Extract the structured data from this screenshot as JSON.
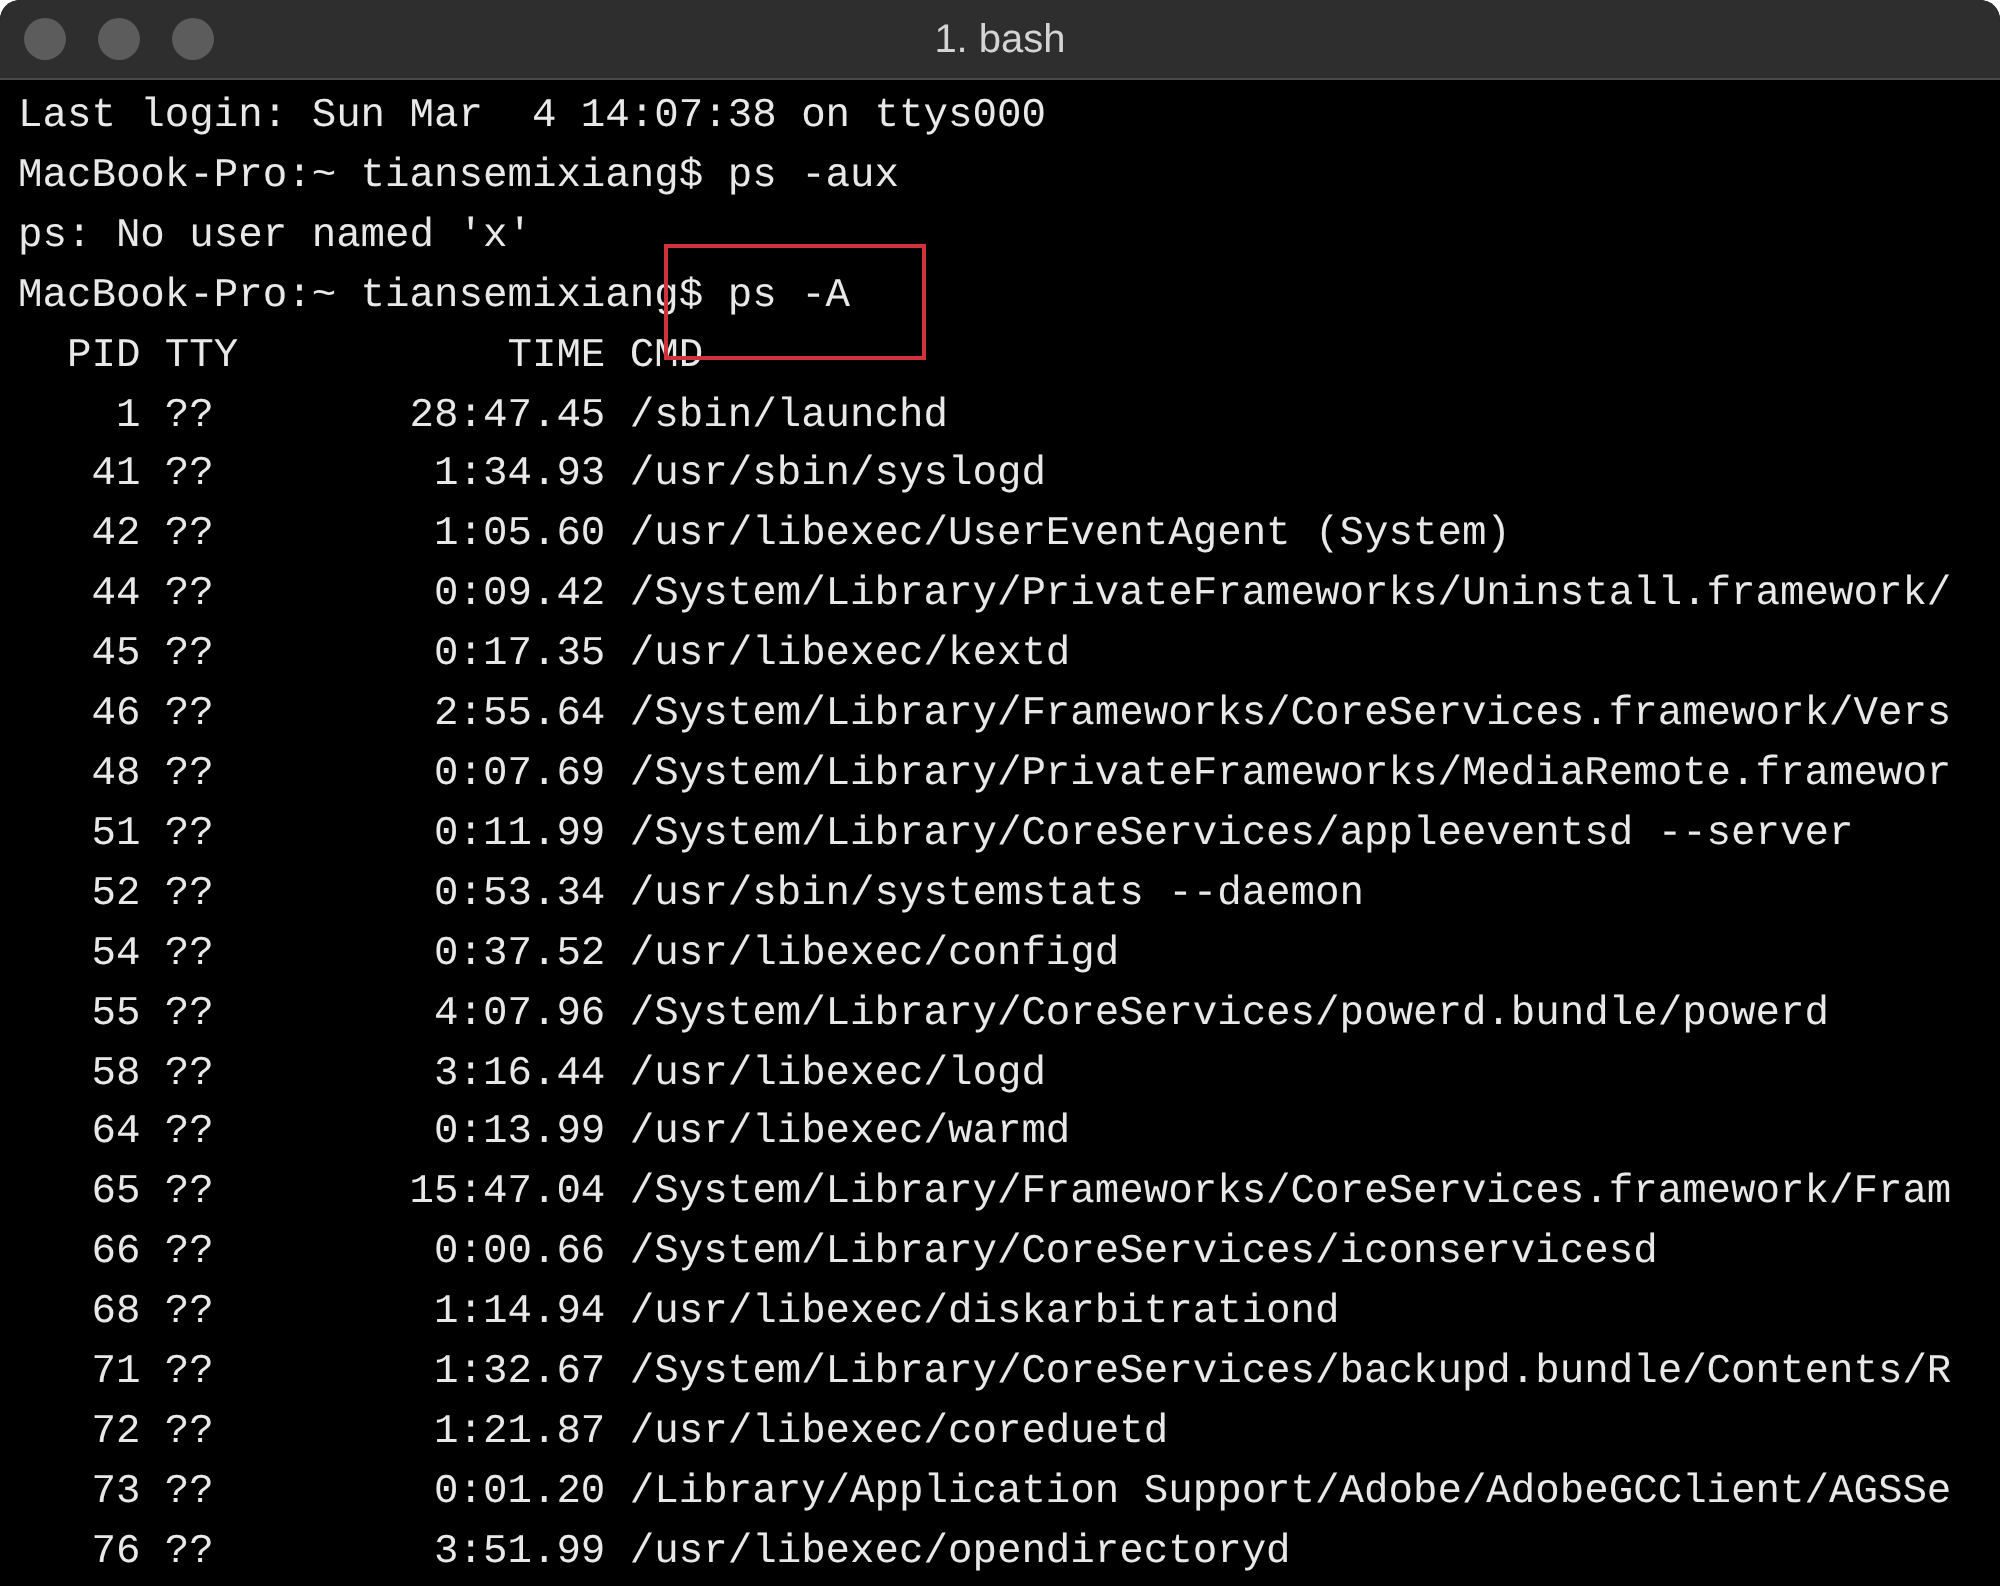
{
  "window": {
    "title": "1. bash"
  },
  "lines": [
    "Last login: Sun Mar  4 14:07:38 on ttys000",
    "MacBook-Pro:~ tiansemixiang$ ps -aux",
    "ps: No user named 'x'",
    "MacBook-Pro:~ tiansemixiang$ ps -A"
  ],
  "ps_table": {
    "columns": [
      "PID",
      "TTY",
      "TIME",
      "CMD"
    ],
    "rows": [
      {
        "pid": "1",
        "tty": "??",
        "time": "28:47.45",
        "cmd": "/sbin/launchd"
      },
      {
        "pid": "41",
        "tty": "??",
        "time": "1:34.93",
        "cmd": "/usr/sbin/syslogd"
      },
      {
        "pid": "42",
        "tty": "??",
        "time": "1:05.60",
        "cmd": "/usr/libexec/UserEventAgent (System)"
      },
      {
        "pid": "44",
        "tty": "??",
        "time": "0:09.42",
        "cmd": "/System/Library/PrivateFrameworks/Uninstall.framework/"
      },
      {
        "pid": "45",
        "tty": "??",
        "time": "0:17.35",
        "cmd": "/usr/libexec/kextd"
      },
      {
        "pid": "46",
        "tty": "??",
        "time": "2:55.64",
        "cmd": "/System/Library/Frameworks/CoreServices.framework/Vers"
      },
      {
        "pid": "48",
        "tty": "??",
        "time": "0:07.69",
        "cmd": "/System/Library/PrivateFrameworks/MediaRemote.framewor"
      },
      {
        "pid": "51",
        "tty": "??",
        "time": "0:11.99",
        "cmd": "/System/Library/CoreServices/appleeventsd --server"
      },
      {
        "pid": "52",
        "tty": "??",
        "time": "0:53.34",
        "cmd": "/usr/sbin/systemstats --daemon"
      },
      {
        "pid": "54",
        "tty": "??",
        "time": "0:37.52",
        "cmd": "/usr/libexec/configd"
      },
      {
        "pid": "55",
        "tty": "??",
        "time": "4:07.96",
        "cmd": "/System/Library/CoreServices/powerd.bundle/powerd"
      },
      {
        "pid": "58",
        "tty": "??",
        "time": "3:16.44",
        "cmd": "/usr/libexec/logd"
      },
      {
        "pid": "64",
        "tty": "??",
        "time": "0:13.99",
        "cmd": "/usr/libexec/warmd"
      },
      {
        "pid": "65",
        "tty": "??",
        "time": "15:47.04",
        "cmd": "/System/Library/Frameworks/CoreServices.framework/Fram"
      },
      {
        "pid": "66",
        "tty": "??",
        "time": "0:00.66",
        "cmd": "/System/Library/CoreServices/iconservicesd"
      },
      {
        "pid": "68",
        "tty": "??",
        "time": "1:14.94",
        "cmd": "/usr/libexec/diskarbitrationd"
      },
      {
        "pid": "71",
        "tty": "??",
        "time": "1:32.67",
        "cmd": "/System/Library/CoreServices/backupd.bundle/Contents/R"
      },
      {
        "pid": "72",
        "tty": "??",
        "time": "1:21.87",
        "cmd": "/usr/libexec/coreduetd"
      },
      {
        "pid": "73",
        "tty": "??",
        "time": "0:01.20",
        "cmd": "/Library/Application Support/Adobe/AdobeGCClient/AGSSe"
      },
      {
        "pid": "76",
        "tty": "??",
        "time": "3:51.99",
        "cmd": "/usr/libexec/opendirectoryd"
      }
    ]
  }
}
